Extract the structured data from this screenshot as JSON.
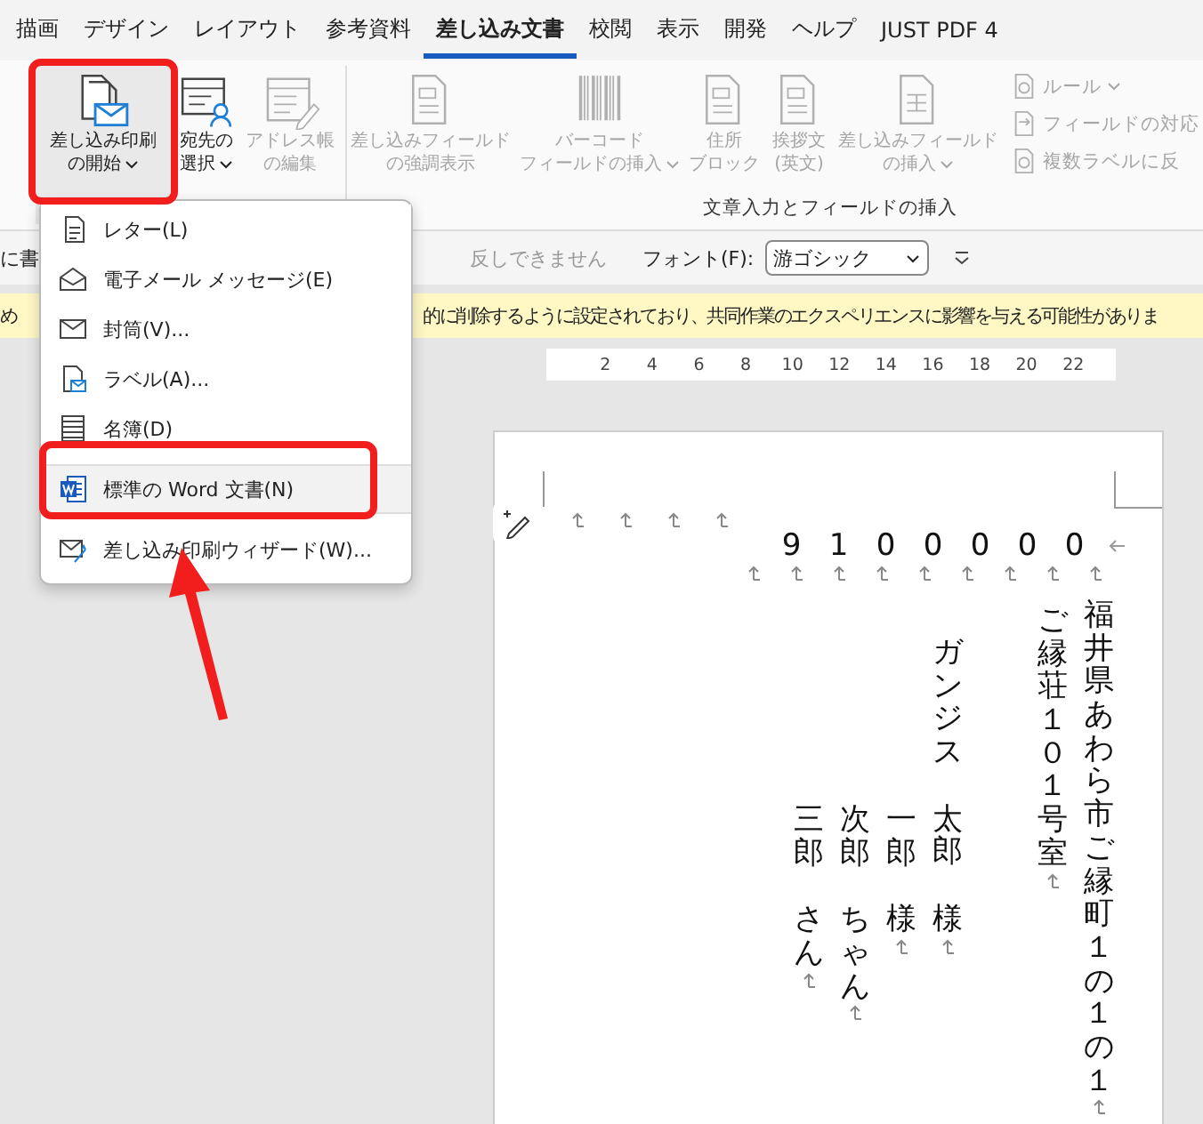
{
  "tabs": [
    {
      "label": "描画",
      "selected": false
    },
    {
      "label": "デザイン",
      "selected": false
    },
    {
      "label": "レイアウト",
      "selected": false
    },
    {
      "label": "参考資料",
      "selected": false
    },
    {
      "label": "差し込み文書",
      "selected": true
    },
    {
      "label": "校閲",
      "selected": false
    },
    {
      "label": "表示",
      "selected": false
    },
    {
      "label": "開発",
      "selected": false
    },
    {
      "label": "ヘルプ",
      "selected": false
    },
    {
      "label": "JUST PDF 4",
      "selected": false
    }
  ],
  "ribbon": {
    "groups": [
      {
        "buttons": [
          {
            "lines": [
              "差し込み印刷",
              "の開始"
            ],
            "caret": true,
            "disabled": false
          },
          {
            "lines": [
              "宛先の",
              "選択"
            ],
            "caret": true,
            "disabled": false
          },
          {
            "lines": [
              "アドレス帳",
              "の編集"
            ],
            "caret": false,
            "disabled": true
          }
        ]
      },
      {
        "label": "文章入力とフィールドの挿入",
        "buttons": [
          {
            "lines": [
              "差し込みフィールド",
              "の強調表示"
            ],
            "caret": false,
            "disabled": true
          },
          {
            "lines": [
              "バーコード",
              "フィールドの挿入"
            ],
            "caret": true,
            "disabled": true
          },
          {
            "lines": [
              "住所",
              "ブロック"
            ],
            "caret": false,
            "disabled": true
          },
          {
            "lines": [
              "挨拶文",
              "(英文)"
            ],
            "caret": false,
            "disabled": true
          },
          {
            "lines": [
              "差し込みフィールド",
              "の挿入"
            ],
            "caret": true,
            "disabled": true
          }
        ],
        "small_buttons": [
          {
            "label": "ルール",
            "caret": true,
            "disabled": true
          },
          {
            "label": "フィールドの対応",
            "caret": false,
            "disabled": true
          },
          {
            "label": "複数ラベルに反",
            "caret": false,
            "disabled": true
          }
        ]
      }
    ]
  },
  "doc_toolbar": {
    "left_text": "に書",
    "notice": "反しできません",
    "font_label": "フォント(F):",
    "font_value": "游ゴシック"
  },
  "info_bar": {
    "prefix": "め",
    "message": "的に削除するように設定されており、共同作業のエクスペリエンスに影響を与える可能性がありま"
  },
  "ruler": [
    "2",
    "4",
    "6",
    "8",
    "10",
    "12",
    "14",
    "16",
    "18",
    "20",
    "22"
  ],
  "menu": {
    "items": [
      {
        "label": "レター(L)",
        "hovered": false
      },
      {
        "label": "電子メール メッセージ(E)",
        "hovered": false
      },
      {
        "label": "封筒(V)...",
        "hovered": false
      },
      {
        "label": "ラベル(A)...",
        "hovered": false
      },
      {
        "label": "名簿(D)",
        "hovered": false
      },
      {
        "label": "標準の Word 文書(N)",
        "hovered": true
      },
      {
        "label": "差し込み印刷ウィザード(W)...",
        "hovered": false
      }
    ]
  },
  "document": {
    "postal_code": [
      "9",
      "1",
      "0",
      "0",
      "0",
      "0",
      "0"
    ],
    "columns": [
      {
        "kind": "family",
        "parts": [
          "三郎",
          "さん"
        ]
      },
      {
        "kind": "family",
        "parts": [
          "次郎",
          "ちゃん"
        ]
      },
      {
        "kind": "family",
        "parts": [
          "一郎",
          "様"
        ]
      },
      {
        "kind": "name",
        "parts": [
          "ガンジス",
          "太郎",
          "様"
        ]
      },
      {
        "kind": "address2",
        "parts": [
          "ご縁荘１０１号室"
        ]
      },
      {
        "kind": "address",
        "parts": [
          "福井県あわら市ご縁町１の１の１"
        ]
      }
    ]
  }
}
